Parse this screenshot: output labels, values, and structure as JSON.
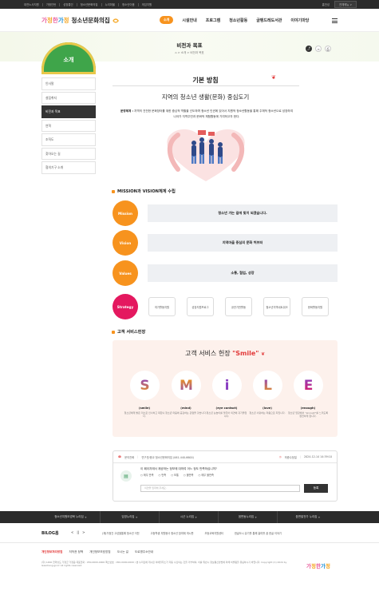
{
  "topbar": {
    "links": [
      "대전노사지원",
      "가정인턴",
      "성장통인",
      "청소년문화의집",
      "누리마을",
      "청소년이음",
      "게임지원"
    ],
    "login": "홈전성",
    "lang": "전체메뉴 ∨"
  },
  "header": {
    "logo_text": "청소년문화의집",
    "nav_sogae": "소개",
    "nav": [
      "시설안내",
      "프로그램",
      "청소년활동",
      "글뱅드레도서관",
      "이야기마당"
    ]
  },
  "page": {
    "title": "비전과 목표",
    "breadcrumb": [
      "⌂",
      ">",
      "소개",
      ">",
      "비전과 목표"
    ]
  },
  "sidebar": {
    "header": "소개",
    "items": [
      "인사말",
      "설립취지",
      "비전과 목표",
      "연혁",
      "조직도",
      "찾아오는 길",
      "협의기구 소개"
    ]
  },
  "main": {
    "section_title": "기본 방침",
    "subtitle": "지역의 청소년 생활(문화) 중심도기",
    "desc_label": "운영체계 :",
    "desc": "지역의 건전한 문화장터를 위한 중심적 역할을 선도하며 청소년 인권에 있어서 지원적 청소년활동을 통해 주체적 청소년으로 성장하여 나아가 지역주민과 문화적 체험활동에 기여하고자 한다."
  },
  "mission": {
    "section": "MISSION과 VISION체계 수립",
    "rows": [
      {
        "label": "Mission",
        "text": "청소년 가는 길에 빛이 되겠습니다.",
        "color": "#f7931e"
      },
      {
        "label": "Vision",
        "text": "지역마을 중심의 문화 허브터",
        "color": "#f7931e"
      },
      {
        "label": "Values",
        "text": "소통, 협업, 성장",
        "color": "#f7931e"
      },
      {
        "label": "Strategy",
        "color": "#e4185f",
        "items": [
          "여가활동지원",
          "성장지원프로그",
          "공관기반활동",
          "청소년지역네트워크",
          "문화활동지원"
        ]
      }
    ]
  },
  "smile": {
    "section": "고객 서비스헌장",
    "title_prefix": "고객 서비스 헌장",
    "title_quote": "\"Smile\"",
    "letters": [
      {
        "ch": "S",
        "word": "(smile)",
        "desc": "청소년에게 밝은 미소로 인사하고 대합니다.",
        "color": "#8a3fc1"
      },
      {
        "ch": "M",
        "word": "(mind)",
        "desc": "청소년 마음에 공감하는 관점을 갖습니다.",
        "color": "#f39c12"
      },
      {
        "ch": "i",
        "word": "(eye contact)",
        "desc": "청소년 눈높이를 맞추어 의견에 귀기울입니다.",
        "color": "#8a3fc1"
      },
      {
        "ch": "L",
        "word": "(love)",
        "desc": "청소년 사랑하는 마음으로 지킵니다.",
        "color": "#f39c12"
      },
      {
        "ch": "E",
        "word": "(enough)",
        "desc": "청소년 입장에서 \"enough\"를 느끼도록 완전하게 합니다.",
        "color": "#8a3fc1"
      }
    ]
  },
  "info": {
    "dept_label": "문의전화",
    "dept": "연구관/종교 청소년문화의집 (061-440-6600)",
    "updated_label": "최종수정일",
    "updated": "2024-12-14 14:39:10"
  },
  "survey": {
    "question": "이 페이지에서 제공하는 정보에 대하여 어느 정도 만족하십니까?",
    "options": [
      "매우 만족",
      "만족",
      "보통",
      "불만족",
      "매우 불만족"
    ],
    "placeholder": "의견을 입력해 주세요.",
    "submit": "등록"
  },
  "footer": {
    "links": [
      "청소년지원모경북 누리집",
      "임영누리집",
      "시군 누리집",
      "읍면동누리집",
      "읍면발전가 누리집"
    ],
    "related_label": "BILOG홈",
    "related_arrows": [
      "<",
      "||",
      ">"
    ],
    "related": [
      "(재)가정건 고성을통해 청소년 이전",
      "고등학생 자원봉사 청소년 참여제 게시판",
      "초등교육지원센터",
      "한글도시 유기를 통해 흥미를 꿈 한글 이야기"
    ],
    "policy": [
      "개인정보처리방침",
      "저작권 정책",
      "개인정보보호방침",
      "오시는 길",
      "도로명주소안내"
    ],
    "address": "(우) 1460 전라남도 가정군 가정읍 대표전화 : 050-0000-0000 팩스번호 : 050-0000-0000 / 본 누리집에 게시된 이메일주소가 자동 수집되는 것을 거부하며, 이를 위반시 정보통신망법에 의해 처벌됨을 유념하시기 바랍니다. Copyright (C) 2024 by Gasoheng.go.kr All rights reserved."
  },
  "colors": {
    "accent": "#f7931e",
    "green": "#3fa54a",
    "strategy": "#e4185f",
    "dark": "#2b2b2b"
  }
}
